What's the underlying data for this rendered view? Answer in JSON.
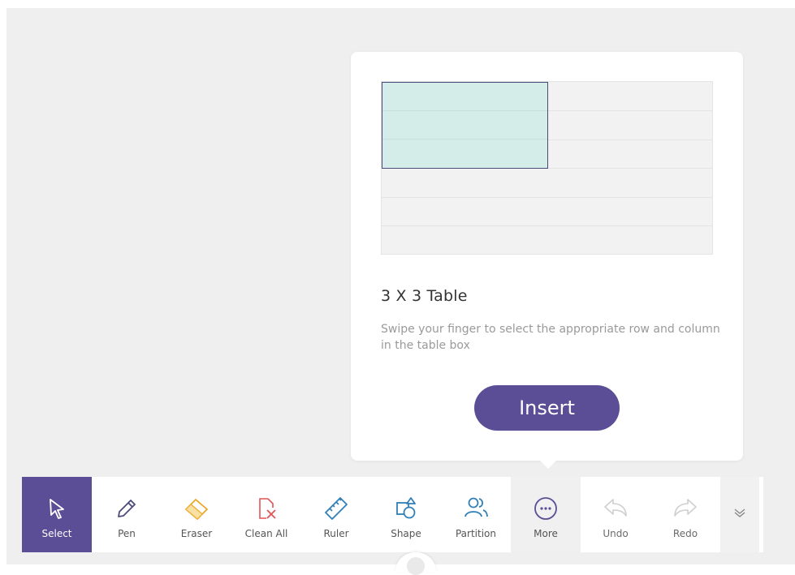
{
  "popup": {
    "title": "3 X 3 Table",
    "description": "Swipe your finger to select the appropriate row and column in the table box",
    "insert_label": "Insert"
  },
  "toolbar": {
    "tools": [
      {
        "label": "Select",
        "icon": "select-cursor-icon",
        "active": true
      },
      {
        "label": "Pen",
        "icon": "pen-icon"
      },
      {
        "label": "Eraser",
        "icon": "eraser-icon"
      },
      {
        "label": "Clean All",
        "icon": "clean-all-icon"
      },
      {
        "label": "Ruler",
        "icon": "ruler-icon"
      },
      {
        "label": "Shape",
        "icon": "shape-icon"
      },
      {
        "label": "Partition",
        "icon": "partition-icon"
      },
      {
        "label": "More",
        "icon": "more-icon",
        "highlighted": true
      },
      {
        "label": "Undo",
        "icon": "undo-icon",
        "disabled": true
      },
      {
        "label": "Redo",
        "icon": "redo-icon",
        "disabled": true
      }
    ],
    "collapse_icon": "chevron-double-down-icon"
  },
  "colors": {
    "accent": "#5b4e96",
    "selection": "#d4ede9",
    "eraser": "#e8a823",
    "clean_all": "#e05555",
    "tool_blue": "#2f7fb8"
  }
}
